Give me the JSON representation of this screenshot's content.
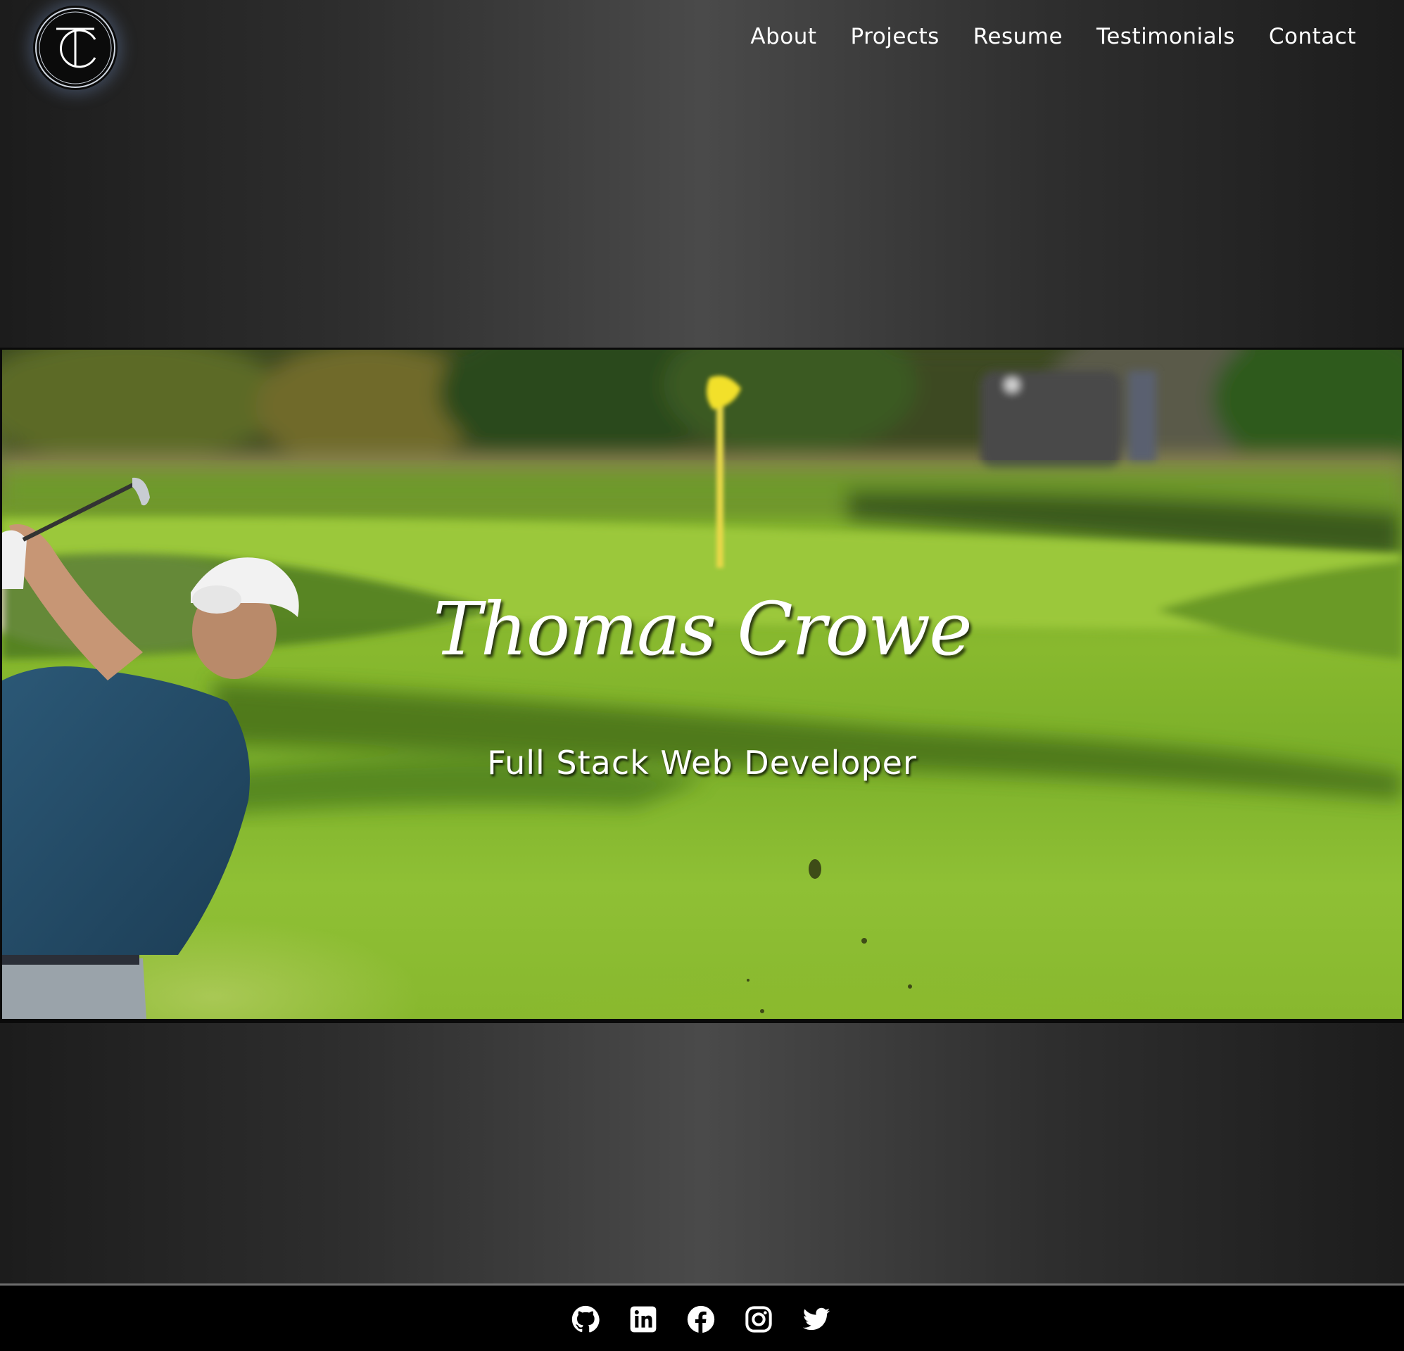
{
  "brand": {
    "logo_icon": "tc-monogram-logo"
  },
  "nav": {
    "items": [
      {
        "label": "About"
      },
      {
        "label": "Projects"
      },
      {
        "label": "Resume"
      },
      {
        "label": "Testimonials"
      },
      {
        "label": "Contact"
      }
    ]
  },
  "hero": {
    "name": "Thomas Crowe",
    "tagline": "Full Stack Web Developer",
    "background_image": "golfer-swinging-on-green-with-yellow-flag"
  },
  "footer": {
    "social": [
      {
        "icon": "github-icon"
      },
      {
        "icon": "linkedin-icon"
      },
      {
        "icon": "facebook-icon"
      },
      {
        "icon": "instagram-icon"
      },
      {
        "icon": "twitter-icon"
      }
    ]
  },
  "colors": {
    "background": "#3a3a3a",
    "text": "#ffffff",
    "footer": "#000000",
    "accent_flag": "#f2e02a"
  }
}
